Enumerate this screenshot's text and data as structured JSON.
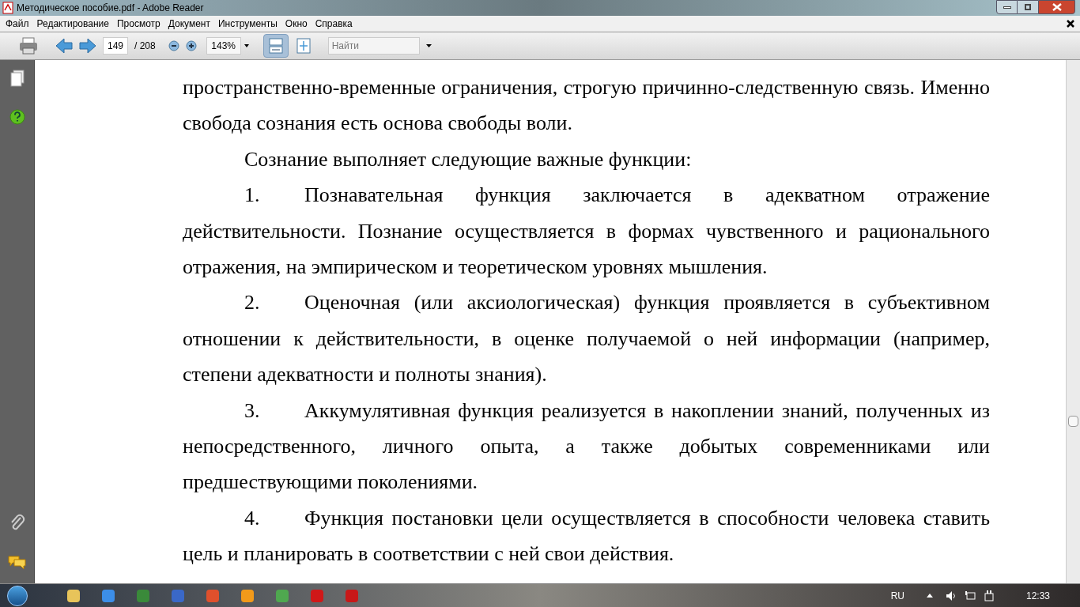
{
  "window": {
    "title": "Методическое пособие.pdf - Adobe Reader"
  },
  "menu": [
    "Файл",
    "Редактирование",
    "Просмотр",
    "Документ",
    "Инструменты",
    "Окно",
    "Справка"
  ],
  "toolbar": {
    "page": "149",
    "page_total": "/ 208",
    "zoom": "143%",
    "search": {
      "placeholder": "Найти"
    },
    "fit_width_selected": true
  },
  "document": {
    "paragraphs": [
      {
        "kind": "continuation",
        "text": "пространственно-временные ограничения, строгую причинно-следственную связь. Именно свобода сознания есть основа свободы воли."
      },
      {
        "kind": "indent",
        "text": "Сознание выполняет следующие важные функции:"
      },
      {
        "kind": "numbered",
        "number": "1.",
        "text": "Познавательная функция заключается в адекватном отражение действительности. Познание осуществляется в формах чувственного и рационального отражения, на эмпирическом и теоретическом уровнях мышления."
      },
      {
        "kind": "numbered",
        "number": "2.",
        "text": "Оценочная (или аксиологическая)  функция проявляется в субъективном отношении к действительности, в оценке получаемой о ней информации (например, степени адекватности и полноты знания)."
      },
      {
        "kind": "numbered",
        "number": "3.",
        "text": "Аккумулятивная функция реализуется в накоплении знаний, полученных из непосредственного, личного опыта, а также добытых современниками или предшествующими поколениями."
      },
      {
        "kind": "numbered",
        "number": "4.",
        "text": "Функция постановки цели осуществляется в способности человека ставить цель и планировать в соответствии с ней свои действия."
      }
    ]
  },
  "taskbar": {
    "language": "RU",
    "time": "12:33"
  }
}
